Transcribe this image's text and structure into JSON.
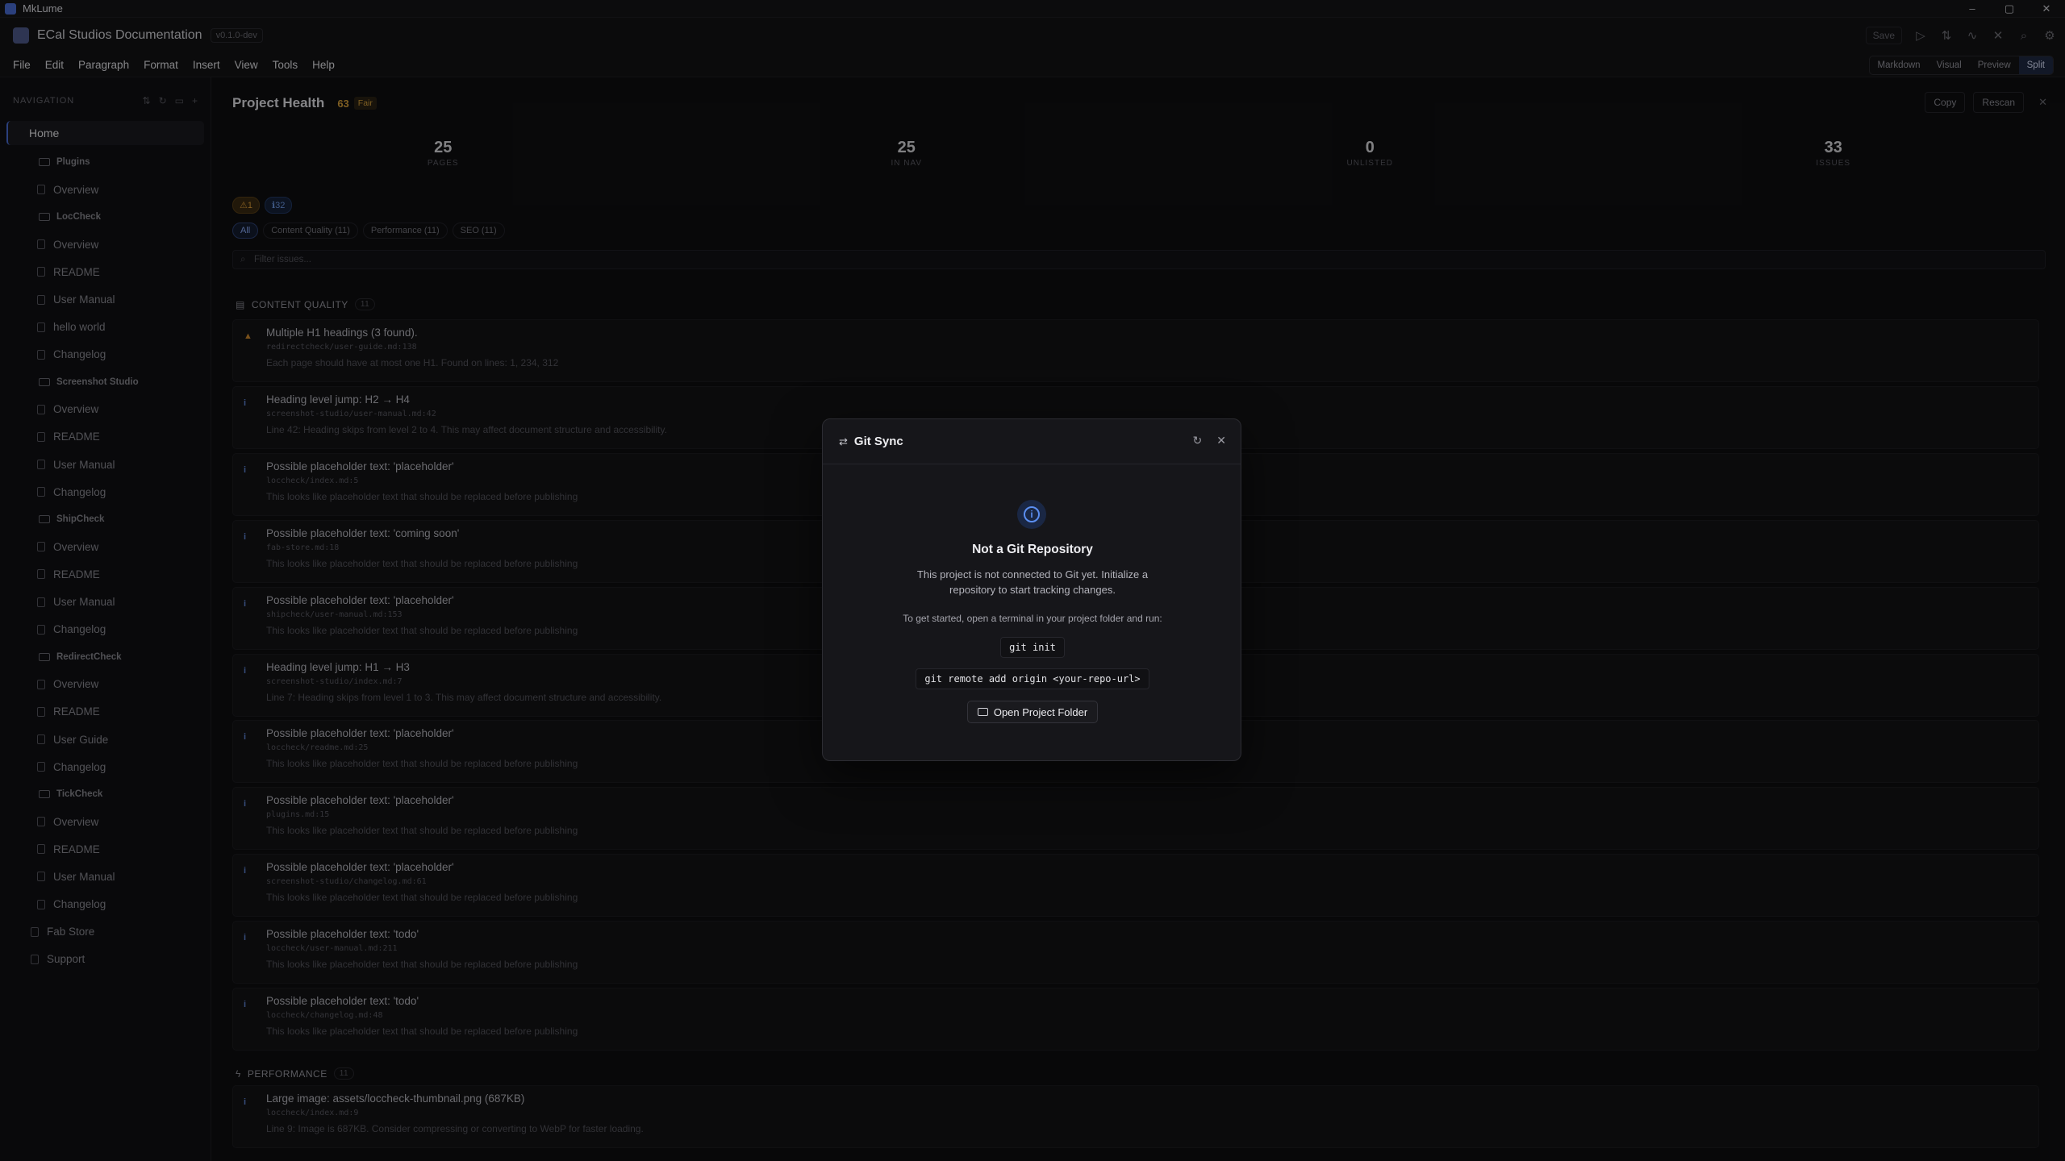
{
  "os": {
    "app_name": "MkLume",
    "controls": [
      "–",
      "▢",
      "✕"
    ]
  },
  "titlebar": {
    "title": "ECal Studios Documentation",
    "version": "v0.1.0-dev",
    "save": "Save"
  },
  "menu": [
    "File",
    "Edit",
    "Paragraph",
    "Format",
    "Insert",
    "View",
    "Tools",
    "Help"
  ],
  "modes": [
    "Markdown",
    "Visual",
    "Preview",
    "Split"
  ],
  "sidebar": {
    "heading": "NAVIGATION",
    "home": "Home",
    "items": [
      {
        "kind": "folder",
        "label": "Plugins"
      },
      {
        "kind": "page",
        "label": "Overview"
      },
      {
        "kind": "folder",
        "label": "LocCheck"
      },
      {
        "kind": "page",
        "label": "Overview"
      },
      {
        "kind": "page",
        "label": "README"
      },
      {
        "kind": "page",
        "label": "User Manual"
      },
      {
        "kind": "page",
        "label": "hello world"
      },
      {
        "kind": "page",
        "label": "Changelog"
      },
      {
        "kind": "folder",
        "label": "Screenshot Studio"
      },
      {
        "kind": "page",
        "label": "Overview"
      },
      {
        "kind": "page",
        "label": "README"
      },
      {
        "kind": "page",
        "label": "User Manual"
      },
      {
        "kind": "page",
        "label": "Changelog"
      },
      {
        "kind": "folder",
        "label": "ShipCheck"
      },
      {
        "kind": "page",
        "label": "Overview"
      },
      {
        "kind": "page",
        "label": "README"
      },
      {
        "kind": "page",
        "label": "User Manual"
      },
      {
        "kind": "page",
        "label": "Changelog"
      },
      {
        "kind": "folder",
        "label": "RedirectCheck"
      },
      {
        "kind": "page",
        "label": "Overview"
      },
      {
        "kind": "page",
        "label": "README"
      },
      {
        "kind": "page",
        "label": "User Guide"
      },
      {
        "kind": "page",
        "label": "Changelog"
      },
      {
        "kind": "folder",
        "label": "TickCheck"
      },
      {
        "kind": "page",
        "label": "Overview"
      },
      {
        "kind": "page",
        "label": "README"
      },
      {
        "kind": "page",
        "label": "User Manual"
      },
      {
        "kind": "page",
        "label": "Changelog"
      },
      {
        "kind": "top",
        "label": "Fab Store"
      },
      {
        "kind": "top",
        "label": "Support"
      }
    ]
  },
  "health": {
    "title": "Project Health",
    "score": "63",
    "rating": "Fair",
    "copy": "Copy",
    "rescan": "Rescan",
    "stats": [
      {
        "value": "25",
        "label": "PAGES"
      },
      {
        "value": "25",
        "label": "IN NAV"
      },
      {
        "value": "0",
        "label": "UNLISTED"
      },
      {
        "value": "33",
        "label": "ISSUES"
      }
    ],
    "badges": {
      "warnings": "⚠1",
      "info": "ℹ32"
    },
    "filters": [
      "All",
      "Content Quality (11)",
      "Performance (11)",
      "SEO (11)"
    ],
    "search_placeholder": "Filter issues...",
    "sections": [
      {
        "title": "CONTENT QUALITY",
        "count": "11"
      },
      {
        "title": "PERFORMANCE",
        "count": "11"
      }
    ],
    "issues": [
      {
        "sev": "warn",
        "title": "Multiple H1 headings (3 found).",
        "path": "redirectcheck/user-guide.md:138",
        "desc": "Each page should have at most one H1. Found on lines: 1, 234, 312"
      },
      {
        "sev": "info",
        "title": "Heading level jump: H2 → H4",
        "path": "screenshot-studio/user-manual.md:42",
        "desc": "Line 42: Heading skips from level 2 to 4. This may affect document structure and accessibility."
      },
      {
        "sev": "info",
        "title": "Possible placeholder text: 'placeholder'",
        "path": "loccheck/index.md:5",
        "desc": "This looks like placeholder text that should be replaced before publishing"
      },
      {
        "sev": "info",
        "title": "Possible placeholder text: 'coming soon'",
        "path": "fab-store.md:18",
        "desc": "This looks like placeholder text that should be replaced before publishing"
      },
      {
        "sev": "info",
        "title": "Possible placeholder text: 'placeholder'",
        "path": "shipcheck/user-manual.md:153",
        "desc": "This looks like placeholder text that should be replaced before publishing"
      },
      {
        "sev": "info",
        "title": "Heading level jump: H1 → H3",
        "path": "screenshot-studio/index.md:7",
        "desc": "Line 7: Heading skips from level 1 to 3. This may affect document structure and accessibility."
      },
      {
        "sev": "info",
        "title": "Possible placeholder text: 'placeholder'",
        "path": "loccheck/readme.md:25",
        "desc": "This looks like placeholder text that should be replaced before publishing"
      },
      {
        "sev": "info",
        "title": "Possible placeholder text: 'placeholder'",
        "path": "plugins.md:15",
        "desc": "This looks like placeholder text that should be replaced before publishing"
      },
      {
        "sev": "info",
        "title": "Possible placeholder text: 'placeholder'",
        "path": "screenshot-studio/changelog.md:61",
        "desc": "This looks like placeholder text that should be replaced before publishing"
      },
      {
        "sev": "info",
        "title": "Possible placeholder text: 'todo'",
        "path": "loccheck/user-manual.md:211",
        "desc": "This looks like placeholder text that should be replaced before publishing"
      },
      {
        "sev": "info",
        "title": "Possible placeholder text: 'todo'",
        "path": "loccheck/changelog.md:48",
        "desc": "This looks like placeholder text that should be replaced before publishing"
      },
      {
        "sev": "info",
        "title": "Large image: assets/loccheck-thumbnail.png (687KB)",
        "path": "loccheck/index.md:9",
        "desc": "Line 9: Image is 687KB. Consider compressing or converting to WebP for faster loading."
      }
    ]
  },
  "modal": {
    "title": "Git Sync",
    "heading": "Not a Git Repository",
    "body": "This project is not connected to Git yet. Initialize a repository to start tracking changes.",
    "instructions": "To get started, open a terminal in your project folder and run:",
    "cmd1": "git init",
    "cmd2": "git remote add origin <your-repo-url>",
    "button": "Open Project Folder"
  },
  "colors": {
    "accent": "#4a6fd8",
    "warning": "#d9a23b",
    "info": "#5b8ef0"
  }
}
